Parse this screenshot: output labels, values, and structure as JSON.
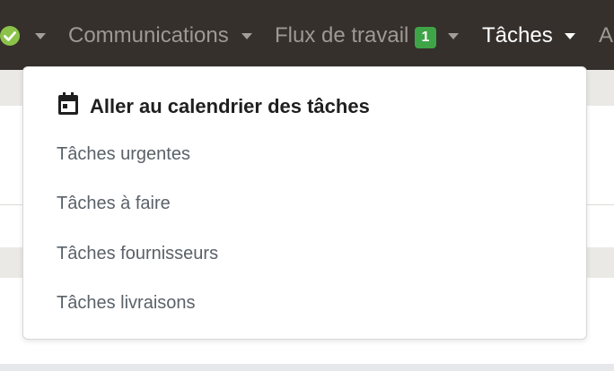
{
  "navbar": {
    "status_icon": "check-circle-icon",
    "items": [
      {
        "label": "Communications"
      },
      {
        "label": "Flux de travail",
        "badge": "1"
      },
      {
        "label": "Tâches"
      },
      {
        "label": "A"
      }
    ]
  },
  "dropdown": {
    "calendar_icon": "calendar-icon",
    "calendar_label": "Aller au calendrier des tâches",
    "items": [
      {
        "label": "Tâches urgentes"
      },
      {
        "label": "Tâches à faire"
      },
      {
        "label": "Tâches fournisseurs"
      },
      {
        "label": "Tâches livraisons"
      }
    ]
  },
  "colors": {
    "navbar_bg": "#35302c",
    "nav_inactive": "#9d9994",
    "nav_active": "#ffffff",
    "badge_bg": "#3fa447",
    "status_green": "#8bc34a"
  }
}
